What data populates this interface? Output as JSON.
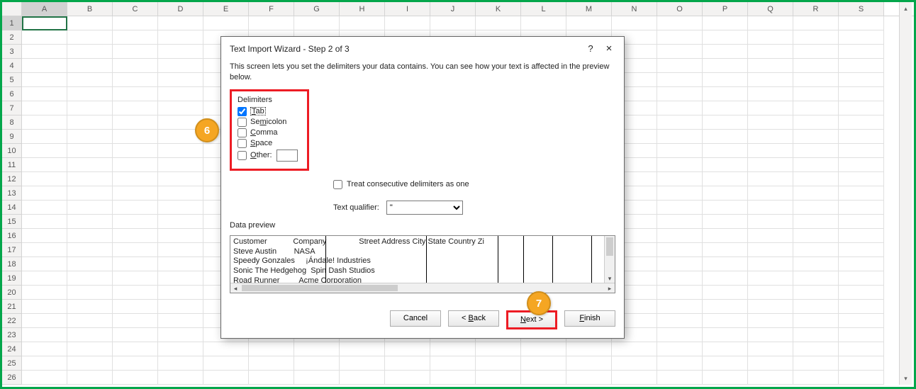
{
  "grid": {
    "columns": [
      "A",
      "B",
      "C",
      "D",
      "E",
      "F",
      "G",
      "H",
      "I",
      "J",
      "K",
      "L",
      "M",
      "N",
      "O",
      "P",
      "Q",
      "R",
      "S"
    ],
    "rows": 26,
    "selected": {
      "row": 1,
      "col": "A"
    }
  },
  "dialog": {
    "title": "Text Import Wizard - Step 2 of 3",
    "help_symbol": "?",
    "close_symbol": "×",
    "description": "This screen lets you set the delimiters your data contains.  You can see how your text is affected in the preview below.",
    "delimiters": {
      "legend": "Delimiters",
      "tab": "Tab",
      "semicolon": "Semicolon",
      "comma": "Comma",
      "space": "Space",
      "other": "Other:",
      "checked": {
        "tab": true,
        "semicolon": false,
        "comma": false,
        "space": false,
        "other": false
      },
      "other_value": ""
    },
    "treat_consecutive": {
      "label": "Treat consecutive delimiters as one",
      "checked": false
    },
    "text_qualifier": {
      "label": "Text qualifier:",
      "value": "\""
    },
    "preview_label": "Data preview",
    "preview": {
      "columns": [
        "Customer",
        "Company",
        "Street Address",
        "City",
        "State",
        "Country",
        "Zi"
      ],
      "rows": [
        [
          "Steve Austin",
          "NASA"
        ],
        [
          "Speedy Gonzales",
          "¡Ándale! Industries"
        ],
        [
          "Sonic The Hedgehog",
          "Spin Dash Studios"
        ],
        [
          "Road Runner",
          "Acme Corporation"
        ]
      ],
      "col_positions": [
        0,
        130,
        272,
        373,
        409,
        450,
        505
      ]
    },
    "buttons": {
      "cancel": "Cancel",
      "back": "< Back",
      "next": "Next >",
      "finish": "Finish"
    }
  },
  "callouts": {
    "six": "6",
    "seven": "7"
  },
  "scroll": {
    "up": "▴",
    "down": "▾",
    "left": "◂",
    "right": "▸"
  }
}
